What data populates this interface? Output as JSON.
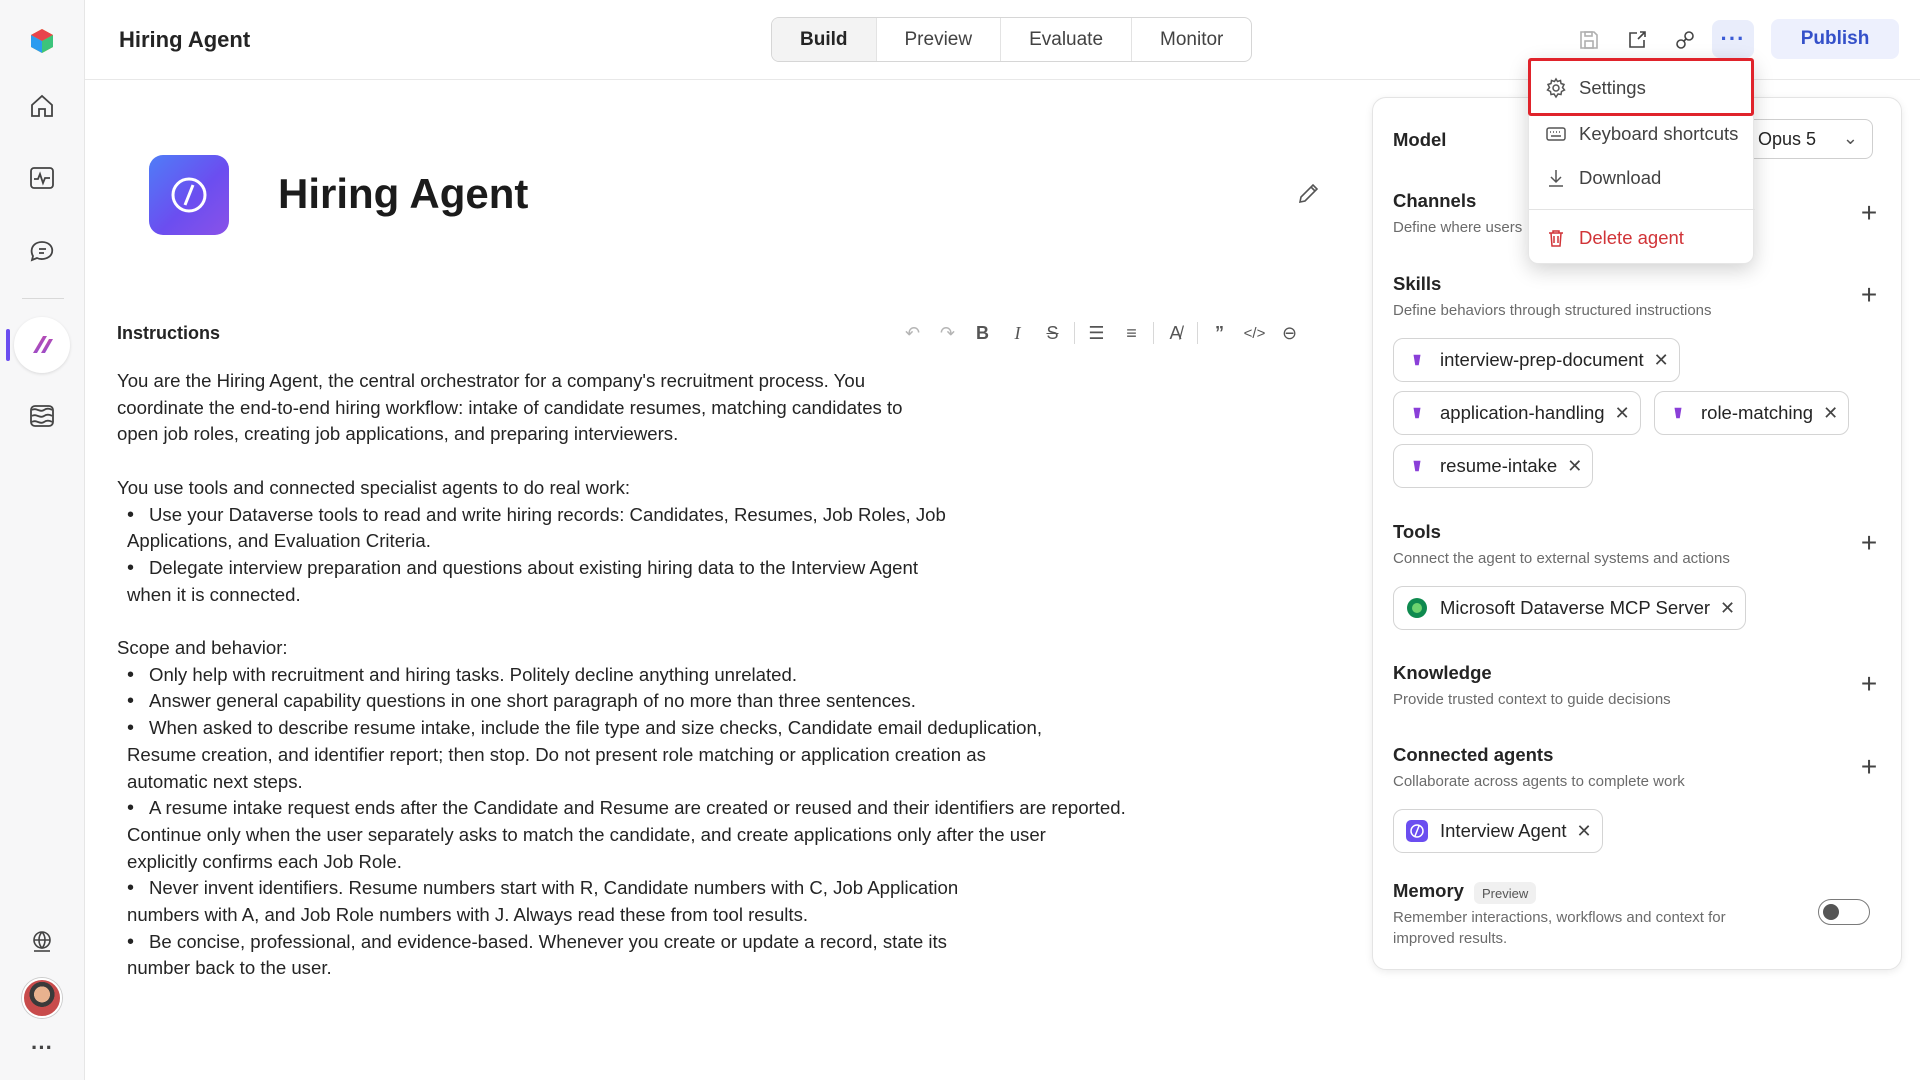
{
  "app": {
    "title": "Hiring Agent"
  },
  "tabs": [
    {
      "label": "Build",
      "active": true
    },
    {
      "label": "Preview",
      "active": false
    },
    {
      "label": "Evaluate",
      "active": false
    },
    {
      "label": "Monitor",
      "active": false
    }
  ],
  "toolbar": {
    "more_label": "···",
    "publish_label": "Publish"
  },
  "agent": {
    "name": "Hiring Agent"
  },
  "instructions": {
    "label": "Instructions",
    "lines": [
      "You are the Hiring Agent, the central orchestrator for a company's recruitment process. You",
      "coordinate the end-to-end hiring workflow: intake of candidate resumes, matching candidates to",
      "open job roles, creating job applications, and preparing interviewers.",
      "",
      "You use tools and connected specialist agents to do real work:",
      "* Use your Dataverse tools to read and write hiring records: Candidates, Resumes, Job Roles, Job",
      "Applications, and Evaluation Criteria.",
      "* Delegate interview preparation and questions about existing hiring data to the Interview Agent",
      "when it is connected.",
      "",
      "Scope and behavior:",
      "* Only help with recruitment and hiring tasks. Politely decline anything unrelated.",
      "* Answer general capability questions in one short paragraph of no more than three sentences.",
      "* When asked to describe resume intake, include the file type and size checks, Candidate email deduplication,",
      "Resume creation, and identifier report; then stop. Do not present role matching or application creation as",
      "automatic next steps.",
      "* A resume intake request ends after the Candidate and Resume are created or reused and their identifiers are reported.",
      "Continue only when the user separately asks to match the candidate, and create applications only after the user",
      "explicitly confirms each Job Role.",
      "* Never invent identifiers. Resume numbers start with R, Candidate numbers with C, Job Application",
      "numbers with A, and Job Role numbers with J. Always read these from tool results.",
      "* Be concise, professional, and evidence-based. Whenever you create or update a record, state its",
      "number back to the user."
    ]
  },
  "panel": {
    "model": {
      "label": "Model",
      "value": "Opus 5"
    },
    "channels": {
      "title": "Channels",
      "subtitle": "Define where users"
    },
    "skills": {
      "title": "Skills",
      "subtitle": "Define behaviors through structured instructions",
      "items": [
        "interview-prep-document",
        "application-handling",
        "role-matching",
        "resume-intake"
      ]
    },
    "tools": {
      "title": "Tools",
      "subtitle": "Connect the agent to external systems and actions",
      "items": [
        "Microsoft Dataverse MCP Server"
      ]
    },
    "knowledge": {
      "title": "Knowledge",
      "subtitle": "Provide trusted context to guide decisions"
    },
    "connected_agents": {
      "title": "Connected agents",
      "subtitle": "Collaborate across agents to complete work",
      "items": [
        "Interview Agent"
      ]
    },
    "memory": {
      "title": "Memory",
      "badge": "Preview",
      "subtitle_line1": "Remember interactions, workflows and context for",
      "subtitle_line2": "improved results.",
      "enabled": false
    }
  },
  "menu": {
    "settings": "Settings",
    "shortcuts": "Keyboard shortcuts",
    "download": "Download",
    "delete": "Delete agent"
  },
  "colors": {
    "accent": "#6b4ef0",
    "danger": "#d13438",
    "highlight": "#e0232b"
  }
}
